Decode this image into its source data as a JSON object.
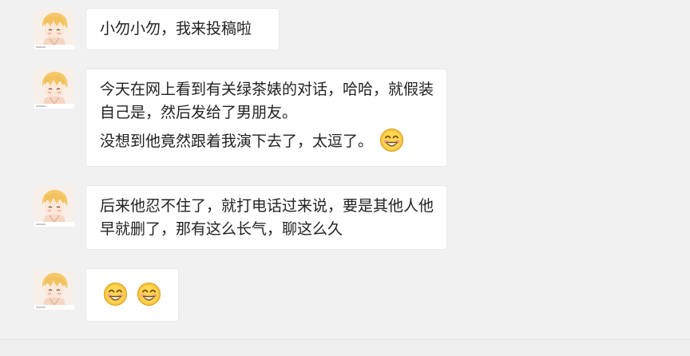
{
  "messages": [
    {
      "sender": "avatar",
      "lines": [
        "小勿小勿，我来投稿啦"
      ]
    },
    {
      "sender": "avatar",
      "lines": [
        "今天在网上看到有关绿茶婊的对话，哈哈，就假装自己是，然后发给了男朋友。",
        "没想到他竟然跟着我演下去了，太逗了。"
      ],
      "trailing_emoji": "grinning-blush-emoji"
    },
    {
      "sender": "avatar",
      "lines": [
        "后来他忍不住了，就打电话过来说，要是其他人他早就删了，那有这么长气，聊这么久"
      ]
    },
    {
      "sender": "avatar",
      "emojis": [
        "grinning-blush-emoji",
        "grinning-blush-emoji"
      ]
    }
  ],
  "colors": {
    "background": "#f1f1f1",
    "bubble": "#ffffff",
    "text": "#222222"
  }
}
